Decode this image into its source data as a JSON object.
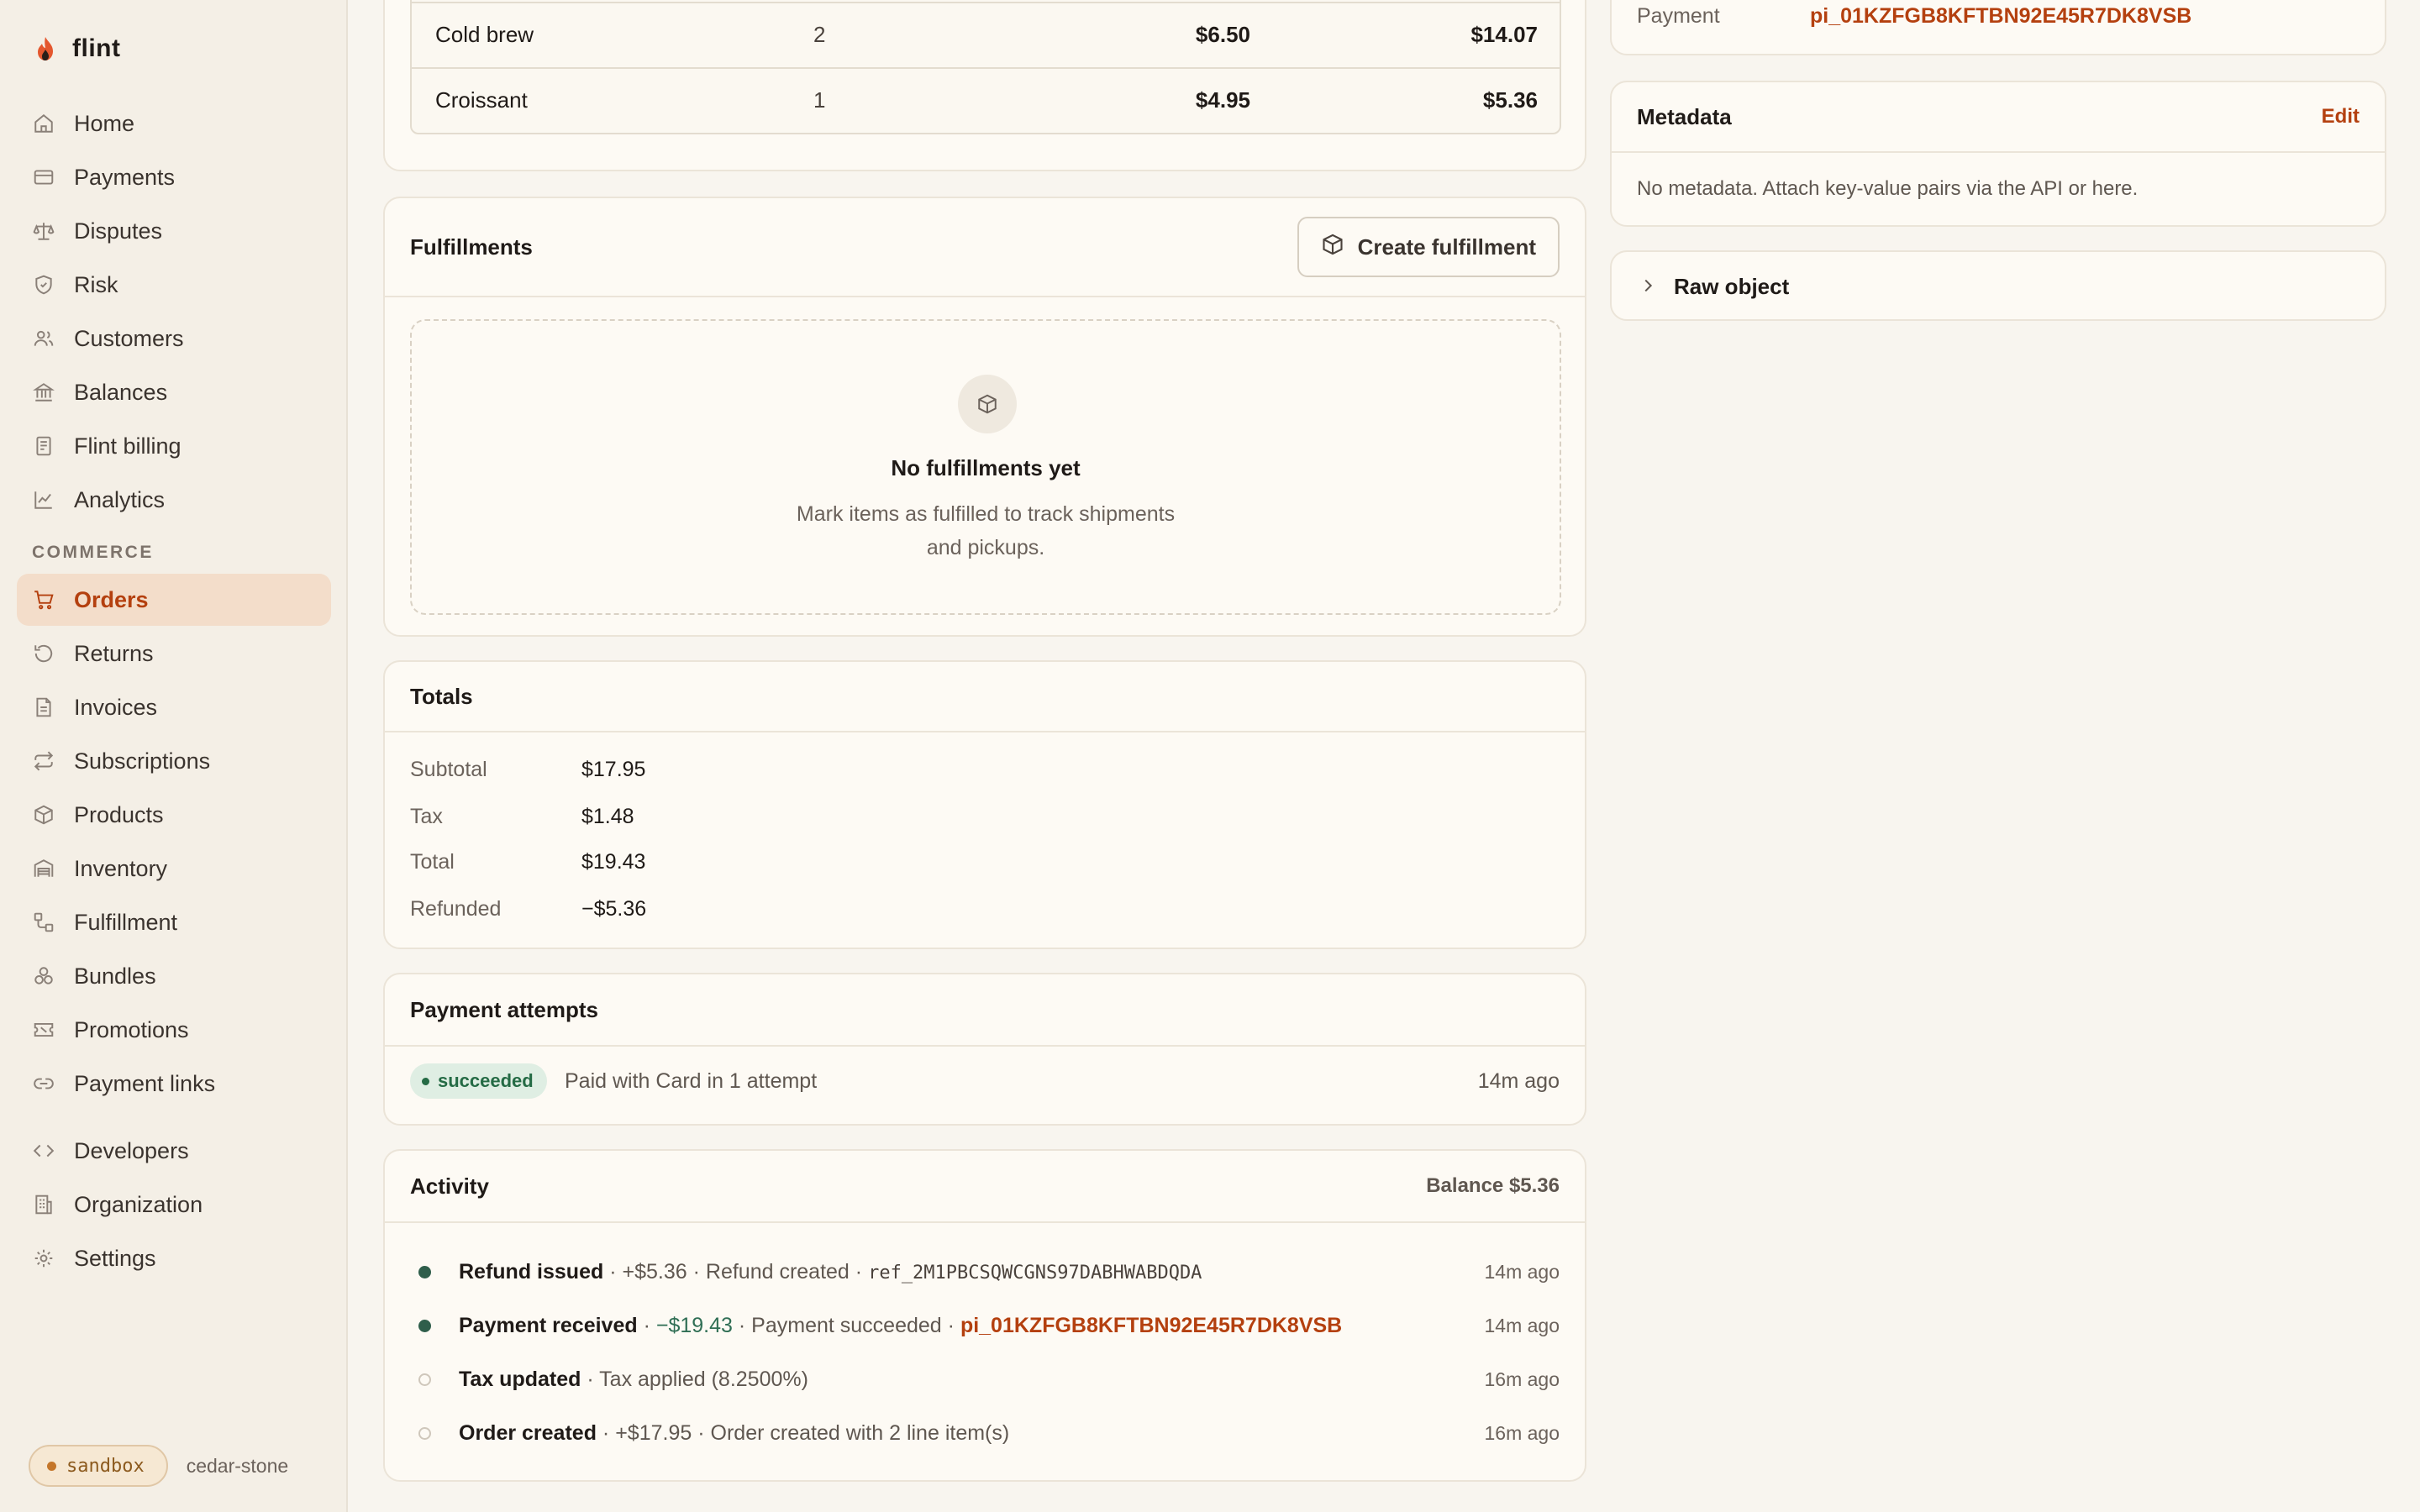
{
  "app": {
    "name": "flint"
  },
  "sidebar": {
    "items": [
      {
        "label": "Home",
        "icon": "home-icon"
      },
      {
        "label": "Payments",
        "icon": "card-icon"
      },
      {
        "label": "Disputes",
        "icon": "scale-icon"
      },
      {
        "label": "Risk",
        "icon": "shield-icon"
      },
      {
        "label": "Customers",
        "icon": "users-icon"
      },
      {
        "label": "Balances",
        "icon": "bank-icon"
      },
      {
        "label": "Flint billing",
        "icon": "document-icon"
      },
      {
        "label": "Analytics",
        "icon": "chart-icon"
      }
    ],
    "section_label": "COMMERCE",
    "commerce_items": [
      {
        "label": "Orders",
        "icon": "cart-icon",
        "active": true
      },
      {
        "label": "Returns",
        "icon": "return-icon"
      },
      {
        "label": "Invoices",
        "icon": "invoice-icon"
      },
      {
        "label": "Subscriptions",
        "icon": "repeat-icon"
      },
      {
        "label": "Products",
        "icon": "box-icon"
      },
      {
        "label": "Inventory",
        "icon": "warehouse-icon"
      },
      {
        "label": "Fulfillment",
        "icon": "fulfillment-icon"
      },
      {
        "label": "Bundles",
        "icon": "bundles-icon"
      },
      {
        "label": "Promotions",
        "icon": "ticket-icon"
      },
      {
        "label": "Payment links",
        "icon": "link-icon"
      }
    ],
    "bottom_items": [
      {
        "label": "Developers",
        "icon": "code-icon"
      },
      {
        "label": "Organization",
        "icon": "building-icon"
      },
      {
        "label": "Settings",
        "icon": "gear-icon"
      }
    ],
    "env": {
      "badge": "sandbox",
      "name": "cedar-stone"
    }
  },
  "line_items": [
    {
      "name": "Cold brew",
      "qty": "2",
      "price": "$6.50",
      "total": "$14.07"
    },
    {
      "name": "Croissant",
      "qty": "1",
      "price": "$4.95",
      "total": "$5.36"
    }
  ],
  "fulfillments": {
    "title": "Fulfillments",
    "button": "Create fulfillment",
    "empty_title": "No fulfillments yet",
    "empty_line1": "Mark items as fulfilled to track shipments",
    "empty_line2": "and pickups."
  },
  "totals": {
    "title": "Totals",
    "rows": [
      {
        "label": "Subtotal",
        "value": "$17.95"
      },
      {
        "label": "Tax",
        "value": "$1.48"
      },
      {
        "label": "Total",
        "value": "$19.43"
      },
      {
        "label": "Refunded",
        "value": "−$5.36"
      }
    ]
  },
  "payment_attempts": {
    "title": "Payment attempts",
    "status": "succeeded",
    "text": "Paid with Card in 1 attempt",
    "time": "14m ago"
  },
  "activity": {
    "title": "Activity",
    "balance": "Balance $5.36",
    "rows": [
      {
        "title": "Refund issued",
        "amount": "+$5.36",
        "desc": "Refund created",
        "ref": "ref_2M1PBCSQWCGNS97DABHWABDQDA",
        "time": "14m ago"
      },
      {
        "title": "Payment received",
        "amount": "−$19.43",
        "desc": "Payment succeeded",
        "ref": "pi_01KZFGB8KFTBN92E45R7DK8VSB",
        "time": "14m ago"
      },
      {
        "title": "Tax updated",
        "desc": "Tax applied (8.2500%)",
        "time": "16m ago"
      },
      {
        "title": "Order created",
        "amount": "+$17.95",
        "desc": "Order created with 2 line item(s)",
        "time": "16m ago"
      }
    ],
    "separator": "·"
  },
  "details": {
    "payment_label": "Payment",
    "payment_value": "pi_01KZFGB8KFTBN92E45R7DK8VSB"
  },
  "metadata": {
    "title": "Metadata",
    "edit": "Edit",
    "empty": "No metadata. Attach key-value pairs via the API or here."
  },
  "raw_object": {
    "title": "Raw object"
  },
  "colors": {
    "accent": "#b4400f",
    "success": "#256b45",
    "background": "#f8f5ef"
  }
}
